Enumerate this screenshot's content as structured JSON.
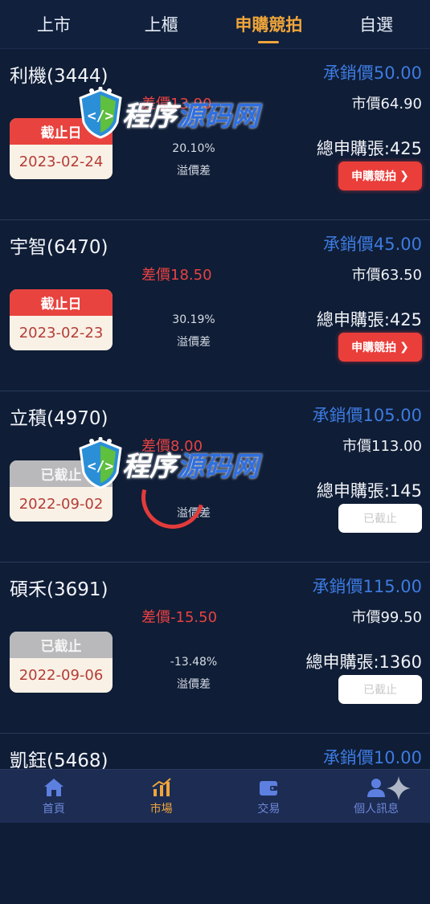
{
  "tabs": [
    {
      "label": "上市"
    },
    {
      "label": "上櫃"
    },
    {
      "label": "申購競拍",
      "active": true
    },
    {
      "label": "自選"
    }
  ],
  "cards": [
    {
      "name": "利機(3444)",
      "price": "承銷價50.00",
      "market": "市價64.90",
      "diff": "差價13.90",
      "pct": "20.10%",
      "pct_label": "溢價差",
      "total": "總申購張:425",
      "date_head": "截止日",
      "date": "2023-02-24",
      "status": "open",
      "action": "申購競拍"
    },
    {
      "name": "宇智(6470)",
      "price": "承銷價45.00",
      "market": "市價63.50",
      "diff": "差價18.50",
      "pct": "30.19%",
      "pct_label": "溢價差",
      "total": "總申購張:425",
      "date_head": "截止日",
      "date": "2023-02-23",
      "status": "open",
      "action": "申購競拍"
    },
    {
      "name": "立積(4970)",
      "price": "承銷價105.00",
      "market": "市價113.00",
      "diff": "差價8.00",
      "pct": "",
      "pct_label": "溢價差",
      "total": "總申購張:145",
      "date_head": "已截止",
      "date": "2022-09-02",
      "status": "closed",
      "action": "已截止"
    },
    {
      "name": "碩禾(3691)",
      "price": "承銷價115.00",
      "market": "市價99.50",
      "diff": "差價-15.50",
      "pct": "-13.48%",
      "pct_label": "溢價差",
      "total": "總申購張:1360",
      "date_head": "已截止",
      "date": "2022-09-06",
      "status": "closed",
      "action": "已截止"
    },
    {
      "name": "凱鈺(5468)",
      "price": "承銷價10.00",
      "market": "",
      "diff": "",
      "pct": "",
      "pct_label": "",
      "total": "",
      "date_head": "",
      "date": "",
      "status": "none",
      "action": ""
    }
  ],
  "nav": [
    {
      "label": "首頁",
      "icon": "home-icon"
    },
    {
      "label": "市場",
      "icon": "market-chart-icon",
      "active": true
    },
    {
      "label": "交易",
      "icon": "wallet-icon"
    },
    {
      "label": "個人訊息",
      "icon": "user-icon"
    }
  ],
  "watermark": {
    "text_a": "程序",
    "text_b": "源码网"
  },
  "colors": {
    "background": "#0f1d36",
    "accent": "#f0a53a",
    "price_blue": "#3d7be0",
    "diff_red": "#e84242",
    "open_red": "#e8433e",
    "closed_gray": "#b9b9bb",
    "nav_bg": "#1c2c52"
  }
}
